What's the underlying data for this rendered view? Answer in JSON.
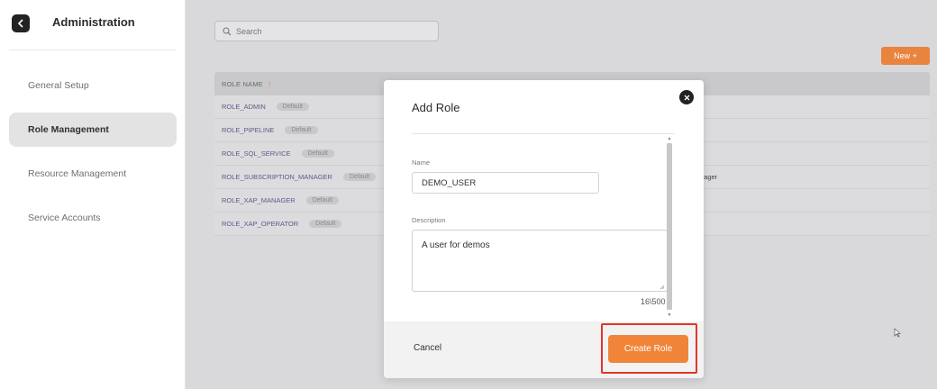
{
  "sidebar": {
    "title": "Administration",
    "items": [
      {
        "label": "General Setup"
      },
      {
        "label": "Role Management"
      },
      {
        "label": "Resource Management"
      },
      {
        "label": "Service Accounts"
      }
    ]
  },
  "main": {
    "search_placeholder": "Search",
    "new_button": "New +",
    "table": {
      "header": "ROLE NAME",
      "sort_glyph": "↑",
      "rows": [
        {
          "name": "ROLE_ADMIN",
          "badge": "Default",
          "extra": ""
        },
        {
          "name": "ROLE_PIPELINE",
          "badge": "Default",
          "extra": ""
        },
        {
          "name": "ROLE_SQL_SERVICE",
          "badge": "Default",
          "extra": ""
        },
        {
          "name": "ROLE_SUBSCRIPTION_MANAGER",
          "badge": "Default",
          "extra": "nager"
        },
        {
          "name": "ROLE_XAP_MANAGER",
          "badge": "Default",
          "extra": ""
        },
        {
          "name": "ROLE_XAP_OPERATOR",
          "badge": "Default",
          "extra": ""
        }
      ]
    }
  },
  "modal": {
    "title": "Add Role",
    "name_label": "Name",
    "name_value": "DEMO_USER",
    "description_label": "Description",
    "description_value": "A user for demos",
    "char_counter": "16\\500",
    "cancel_label": "Cancel",
    "create_label": "Create Role"
  },
  "colors": {
    "accent": "#f0853a",
    "highlight": "#e0362a",
    "sidebar_active": "#e3e3e3"
  }
}
